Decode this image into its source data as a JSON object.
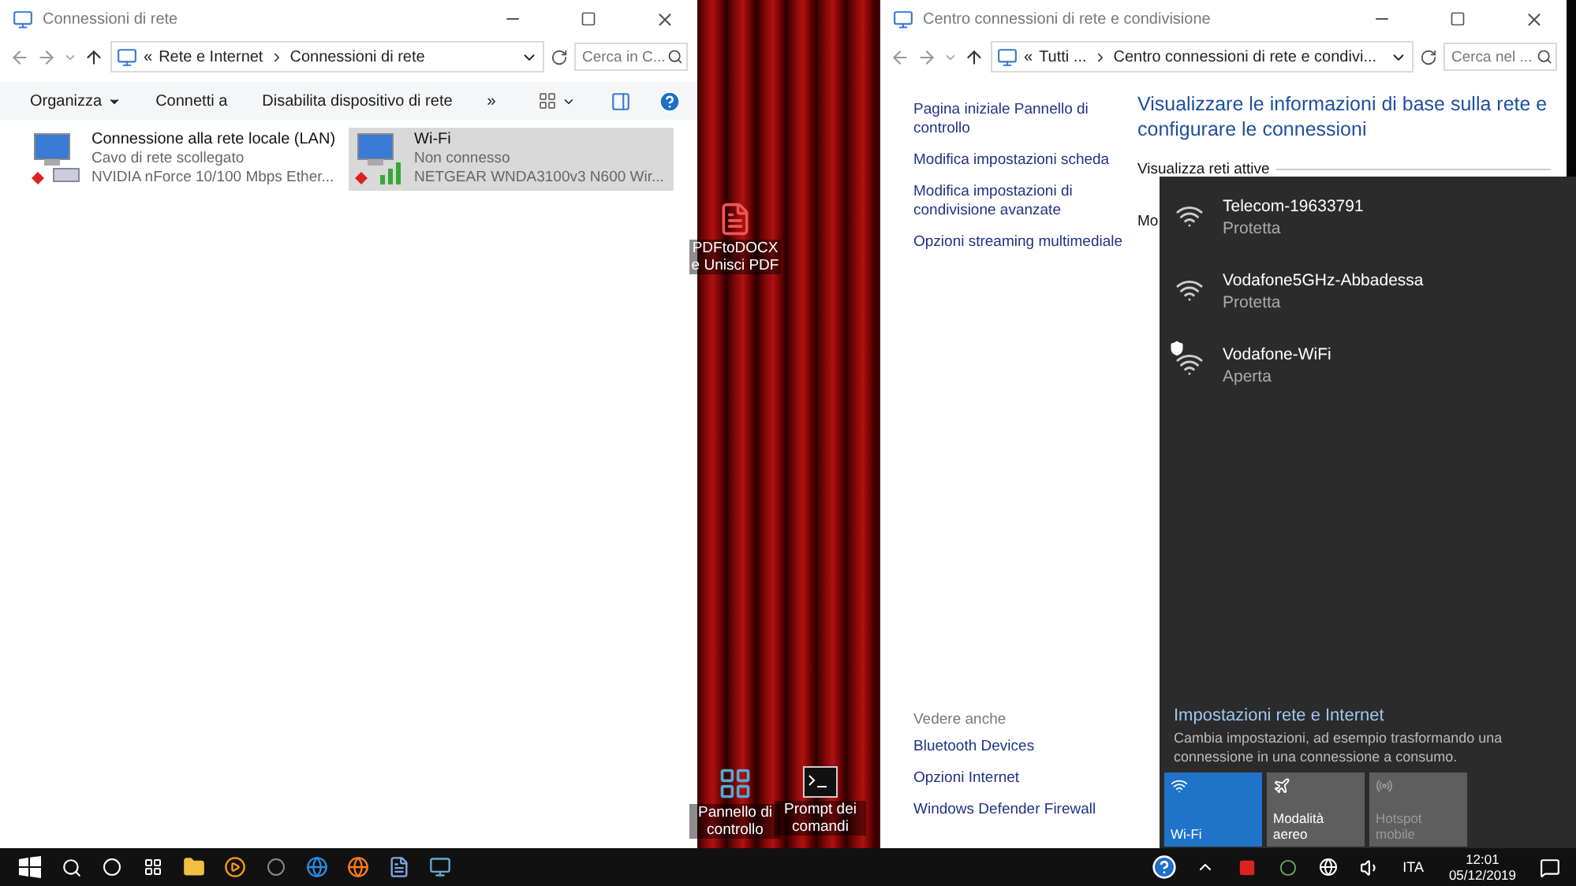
{
  "left_window": {
    "title": "Connessioni di rete",
    "breadcrumb_prefix": "«",
    "breadcrumb": [
      "Rete e Internet",
      "Connessioni di rete"
    ],
    "search": {
      "placeholder": "Cerca in C..."
    },
    "toolbar": [
      {
        "label": "Organizza",
        "dropdown": true
      },
      {
        "label": "Connetti a",
        "dropdown": false
      },
      {
        "label": "Disabilita dispositivo di rete",
        "dropdown": false
      }
    ],
    "more": "»",
    "connections": [
      {
        "kind": "ethernet",
        "name": "Connessione alla rete locale (LAN)",
        "status": "Cavo di rete scollegato",
        "device": "NVIDIA nForce 10/100 Mbps Ether...",
        "selected": false
      },
      {
        "kind": "wifi",
        "name": "Wi-Fi",
        "status": "Non connesso",
        "device": "NETGEAR WNDA3100v3 N600 Wir...",
        "selected": true
      }
    ]
  },
  "right_window": {
    "title": "Centro connessioni di rete e condivisione",
    "breadcrumb_prefix": "«",
    "breadcrumb": [
      "Tutti ...",
      "Centro connessioni di rete e condivi..."
    ],
    "search": {
      "placeholder": "Cerca nel ..."
    },
    "sidebar_links": [
      "Pagina iniziale Pannello di controllo",
      "Modifica impostazioni scheda",
      "Modifica impostazioni di condivisione avanzate",
      "Opzioni streaming multimediale"
    ],
    "heading": "Visualizzare le informazioni di base sulla rete e configurare le connessioni",
    "section": "Visualizza reti attive",
    "partial_label": "Mo",
    "see_also": {
      "title": "Vedere anche",
      "links": [
        "Bluetooth Devices",
        "Opzioni Internet",
        "Windows Defender Firewall"
      ]
    }
  },
  "desktop_icons": [
    {
      "kind": "pdf",
      "label": "PDFtoDOCX e Unisci PDF"
    },
    {
      "kind": "control-panel",
      "label": "Pannello di controllo"
    },
    {
      "kind": "terminal",
      "label": "Prompt dei comandi"
    }
  ],
  "flyout": {
    "networks": [
      {
        "name": "Telecom-19633791",
        "status": "Protetta",
        "secured": true
      },
      {
        "name": "Vodafone5GHz-Abbadessa",
        "status": "Protetta",
        "secured": true
      },
      {
        "name": "Vodafone-WiFi",
        "status": "Aperta",
        "secured": false
      }
    ],
    "settings_title": "Impostazioni rete e Internet",
    "settings_text": "Cambia impostazioni, ad esempio trasformando una connessione in una connessione a consumo.",
    "quick_actions": [
      {
        "kind": "wifi",
        "label": "Wi-Fi",
        "on": true,
        "disabled": false
      },
      {
        "kind": "airplane",
        "label": "Modalità aereo",
        "on": false,
        "disabled": false
      },
      {
        "kind": "hotspot",
        "label": "Hotspot mobile",
        "on": false,
        "disabled": true
      }
    ]
  },
  "taskbar": {
    "language": "ITA",
    "time": "12:01",
    "date": "05/12/2019"
  }
}
